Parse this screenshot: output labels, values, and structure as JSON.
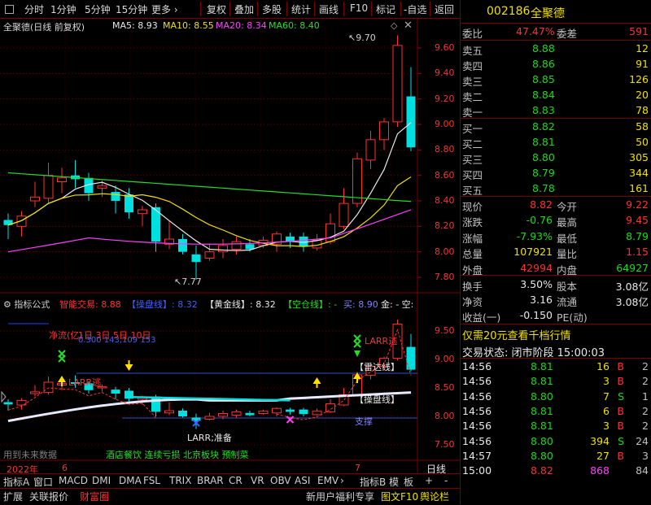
{
  "toolbar": {
    "items": [
      "分时",
      "1分钟",
      "5分钟",
      "15分钟",
      "更多 ›",
      "复权",
      "叠加",
      "多股",
      "统计",
      "画线",
      "F10",
      "标记",
      "-自选",
      "返回"
    ]
  },
  "main_header": {
    "stock_label": "全聚德(日线 前复权)",
    "ma5": "MA5: 8.93",
    "ma10": "MA10: 8.55",
    "ma20": "MA20: 8.34",
    "ma60": "MA60: 8.40",
    "high_mark": "9.70",
    "low_mark": "7.77"
  },
  "price_axis": [
    "9.60",
    "9.40",
    "9.20",
    "9.00",
    "8.80",
    "8.60",
    "8.40",
    "8.20",
    "8.00",
    "7.80"
  ],
  "ind_axis": [
    "9.50",
    "9.00",
    "8.50",
    "8.00",
    "7.50"
  ],
  "indicator_header": {
    "title": "指标公式",
    "smart": "智能交易: 8.88",
    "pan": "【操盘线】: 8.32",
    "gold": "【黄金线】: 8.32",
    "empty": "【空仓线】: -",
    "buy": "买: 8.90",
    "tail": "金: - 空:"
  },
  "indicator_labels": {
    "netflow": "净流(亿)",
    "days": "1日  3日  5日  10日",
    "values": "0.300 143,109 153",
    "larr1": "LARR逃",
    "larr2": "LARR逃",
    "larr_ready": "LARR;准备",
    "radar": "【雷达线】",
    "pan_line": "【操盘线】",
    "support": "支撑",
    "future": "用到未来数据",
    "concepts": "酒店餐饮 连续亏损 北京板块 预制菜"
  },
  "date_axis": {
    "year": "2022年",
    "m1": "6",
    "m2": "7"
  },
  "chart_data": {
    "type": "candlestick",
    "price_range": [
      7.7,
      9.75
    ],
    "candles": [
      {
        "o": 8.25,
        "c": 8.21,
        "h": 8.3,
        "l": 8.1
      },
      {
        "o": 8.2,
        "c": 8.28,
        "h": 8.32,
        "l": 8.12
      },
      {
        "o": 8.4,
        "c": 8.43,
        "h": 8.55,
        "l": 8.35
      },
      {
        "o": 8.42,
        "c": 8.6,
        "h": 8.7,
        "l": 8.38
      },
      {
        "o": 8.55,
        "c": 8.58,
        "h": 8.66,
        "l": 8.46
      },
      {
        "o": 8.6,
        "c": 8.57,
        "h": 8.72,
        "l": 8.5
      },
      {
        "o": 8.58,
        "c": 8.46,
        "h": 8.62,
        "l": 8.4
      },
      {
        "o": 8.5,
        "c": 8.52,
        "h": 8.56,
        "l": 8.43
      },
      {
        "o": 8.47,
        "c": 8.4,
        "h": 8.52,
        "l": 8.3
      },
      {
        "o": 8.45,
        "c": 8.31,
        "h": 8.5,
        "l": 8.26
      },
      {
        "o": 8.3,
        "c": 8.33,
        "h": 8.36,
        "l": 8.2
      },
      {
        "o": 8.35,
        "c": 8.08,
        "h": 8.38,
        "l": 8.0
      },
      {
        "o": 8.06,
        "c": 8.1,
        "h": 8.25,
        "l": 8.02
      },
      {
        "o": 8.1,
        "c": 8.0,
        "h": 8.14,
        "l": 7.98
      },
      {
        "o": 7.98,
        "c": 7.92,
        "h": 8.05,
        "l": 7.78
      },
      {
        "o": 7.95,
        "c": 8.0,
        "h": 8.06,
        "l": 7.93
      },
      {
        "o": 8.0,
        "c": 8.05,
        "h": 8.1,
        "l": 7.95
      },
      {
        "o": 8.02,
        "c": 8.08,
        "h": 8.12,
        "l": 7.98
      },
      {
        "o": 8.06,
        "c": 8.02,
        "h": 8.1,
        "l": 8.0
      },
      {
        "o": 8.05,
        "c": 8.09,
        "h": 8.12,
        "l": 8.03
      },
      {
        "o": 8.06,
        "c": 8.14,
        "h": 8.16,
        "l": 8.0
      },
      {
        "o": 8.12,
        "c": 8.08,
        "h": 8.15,
        "l": 8.03
      },
      {
        "o": 8.12,
        "c": 8.04,
        "h": 8.15,
        "l": 8.0
      },
      {
        "o": 8.03,
        "c": 8.09,
        "h": 8.14,
        "l": 8.01
      },
      {
        "o": 8.08,
        "c": 8.22,
        "h": 8.3,
        "l": 8.06
      },
      {
        "o": 8.2,
        "c": 8.38,
        "h": 8.5,
        "l": 8.18
      },
      {
        "o": 8.38,
        "c": 8.73,
        "h": 8.78,
        "l": 8.35
      },
      {
        "o": 8.72,
        "c": 8.88,
        "h": 8.95,
        "l": 8.65
      },
      {
        "o": 8.88,
        "c": 9.02,
        "h": 9.05,
        "l": 8.8
      },
      {
        "o": 9.02,
        "c": 9.62,
        "h": 9.7,
        "l": 8.98
      },
      {
        "o": 9.22,
        "c": 8.82,
        "h": 9.45,
        "l": 8.79
      }
    ]
  },
  "quote": {
    "code": "002186",
    "name": "全聚德",
    "weibi_label": "委比",
    "weibi": "47.47%",
    "weicha_label": "委差",
    "weicha": "591",
    "asks": [
      {
        "label": "卖五",
        "price": "8.88",
        "vol": "12"
      },
      {
        "label": "卖四",
        "price": "8.86",
        "vol": "91"
      },
      {
        "label": "卖三",
        "price": "8.85",
        "vol": "126"
      },
      {
        "label": "卖二",
        "price": "8.84",
        "vol": "20"
      },
      {
        "label": "卖一",
        "price": "8.83",
        "vol": "78"
      }
    ],
    "bids": [
      {
        "label": "买一",
        "price": "8.82",
        "vol": "58"
      },
      {
        "label": "买二",
        "price": "8.81",
        "vol": "50"
      },
      {
        "label": "买三",
        "price": "8.80",
        "vol": "305"
      },
      {
        "label": "买四",
        "price": "8.79",
        "vol": "344"
      },
      {
        "label": "买五",
        "price": "8.78",
        "vol": "161"
      }
    ],
    "stats": [
      {
        "l1": "现价",
        "v1": "8.82",
        "c1": "red",
        "l2": "今开",
        "v2": "9.22",
        "c2": "red"
      },
      {
        "l1": "涨跌",
        "v1": "-0.76",
        "c1": "green",
        "l2": "最高",
        "v2": "9.45",
        "c2": "red"
      },
      {
        "l1": "涨幅",
        "v1": "-7.93%",
        "c1": "green",
        "l2": "最低",
        "v2": "8.79",
        "c2": "green"
      },
      {
        "l1": "总量",
        "v1": "107921",
        "c1": "yellow",
        "l2": "量比",
        "v2": "1.15",
        "c2": "red"
      },
      {
        "l1": "外盘",
        "v1": "42994",
        "c1": "red",
        "l2": "内盘",
        "v2": "64927",
        "c2": "green"
      }
    ],
    "stats2": [
      {
        "l1": "换手",
        "v1": "3.50%",
        "l2": "股本",
        "v2": "3.08亿"
      },
      {
        "l1": "净资",
        "v1": "3.16",
        "l2": "流通",
        "v2": "3.08亿"
      },
      {
        "l1": "收益(一)",
        "v1": "-0.150",
        "l2": "PE(动)",
        "v2": ""
      }
    ],
    "promo": "仅需20元查看千档行情",
    "status": "交易状态: 闭市阶段 15:00:03",
    "ticks": [
      {
        "t": "14:56",
        "p": "8.81",
        "v": "16",
        "s": "B",
        "n": "2"
      },
      {
        "t": "14:56",
        "p": "8.81",
        "v": "3",
        "s": "B",
        "n": "2"
      },
      {
        "t": "14:56",
        "p": "8.80",
        "v": "7",
        "s": "S",
        "n": "1"
      },
      {
        "t": "14:56",
        "p": "8.81",
        "v": "6",
        "s": "B",
        "n": "2"
      },
      {
        "t": "14:56",
        "p": "8.81",
        "v": "3",
        "s": "B",
        "n": "2"
      },
      {
        "t": "14:56",
        "p": "8.80",
        "v": "394",
        "s": "S",
        "n": "24"
      },
      {
        "t": "14:57",
        "p": "8.80",
        "v": "27",
        "s": "B",
        "n": "3"
      },
      {
        "t": "15:00",
        "p": "8.82",
        "v": "868",
        "s": "",
        "n": "84"
      }
    ]
  },
  "bottom_tabs": {
    "row1": [
      "指标A",
      "窗口",
      "MACD",
      "DMI",
      "DMA",
      "FSL",
      "TRIX",
      "BRAR",
      "CR",
      "VR",
      "OBV",
      "ASI",
      "EMV",
      "›",
      "指标B",
      "模",
      "板",
      "+",
      "-"
    ],
    "row2": [
      "扩展",
      "关联报价",
      "财富圈"
    ],
    "right_links": [
      "新用户福利专享",
      "图文F10",
      "舆论栏"
    ],
    "right_icons": [
      "笔",
      "价",
      "分",
      "势",
      "联",
      "值",
      "主",
      "筹"
    ],
    "day_line": "日线"
  }
}
